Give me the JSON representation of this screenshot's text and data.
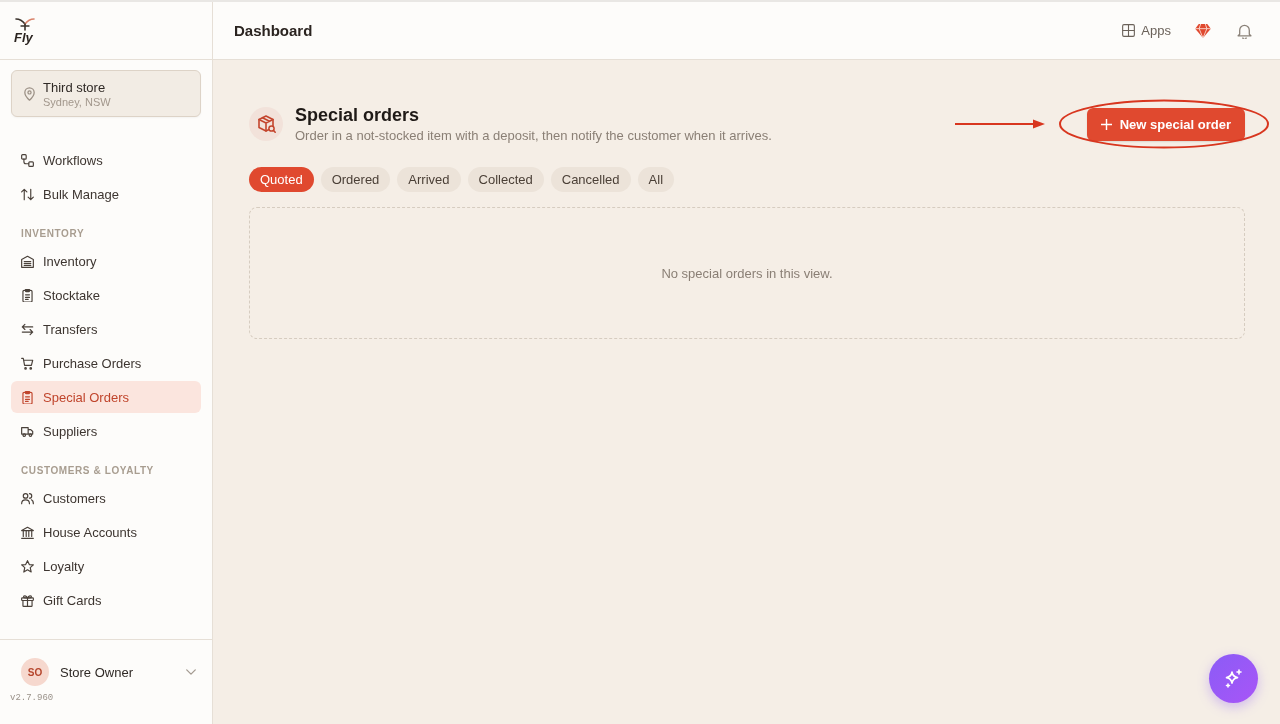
{
  "sidebar": {
    "logo": "Fly",
    "store": {
      "name": "Third store",
      "location": "Sydney, NSW"
    },
    "sections": [
      {
        "items": [
          {
            "label": "Workflows",
            "selected": false
          },
          {
            "label": "Bulk Manage",
            "selected": false
          }
        ]
      },
      {
        "title": "INVENTORY",
        "items": [
          {
            "label": "Inventory",
            "selected": false
          },
          {
            "label": "Stocktake",
            "selected": false
          },
          {
            "label": "Transfers",
            "selected": false
          },
          {
            "label": "Purchase Orders",
            "selected": false
          },
          {
            "label": "Special Orders",
            "selected": true
          },
          {
            "label": "Suppliers",
            "selected": false
          }
        ]
      },
      {
        "title": "CUSTOMERS & LOYALTY",
        "items": [
          {
            "label": "Customers",
            "selected": false
          },
          {
            "label": "House Accounts",
            "selected": false
          },
          {
            "label": "Loyalty",
            "selected": false
          },
          {
            "label": "Gift Cards",
            "selected": false
          }
        ]
      }
    ],
    "user": {
      "initials": "SO",
      "name": "Store Owner"
    },
    "version": "v2.7.960"
  },
  "header": {
    "title": "Dashboard",
    "apps_label": "Apps"
  },
  "page": {
    "title": "Special orders",
    "subtitle": "Order in a not-stocked item with a deposit, then notify the customer when it arrives.",
    "new_button": "New special order",
    "filters": [
      {
        "label": "Quoted",
        "selected": true
      },
      {
        "label": "Ordered",
        "selected": false
      },
      {
        "label": "Arrived",
        "selected": false
      },
      {
        "label": "Collected",
        "selected": false
      },
      {
        "label": "Cancelled",
        "selected": false
      },
      {
        "label": "All",
        "selected": false
      }
    ],
    "empty_message": "No special orders in this view."
  }
}
